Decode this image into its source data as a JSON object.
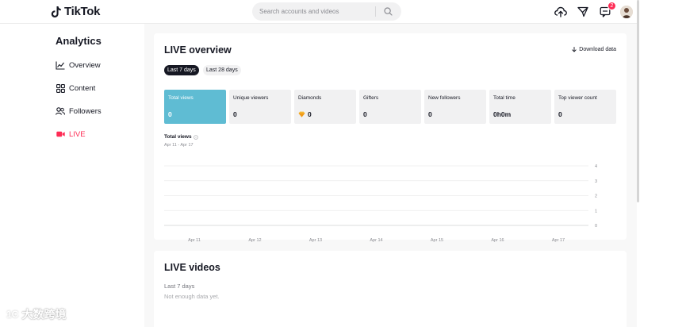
{
  "header": {
    "logo_text": "TikTok",
    "search_placeholder": "Search accounts and videos",
    "notification_count": "2"
  },
  "sidebar": {
    "title": "Analytics",
    "items": [
      {
        "label": "Overview",
        "icon": "line-chart-icon"
      },
      {
        "label": "Content",
        "icon": "grid-icon"
      },
      {
        "label": "Followers",
        "icon": "users-icon"
      },
      {
        "label": "LIVE",
        "icon": "live-icon",
        "active": true
      }
    ]
  },
  "overview": {
    "title": "LIVE overview",
    "download_label": "Download data",
    "ranges": [
      "Last 7 days",
      "Last 28 days"
    ],
    "selected_range": "Last 7 days",
    "metrics": [
      {
        "label": "Total views",
        "value": "0"
      },
      {
        "label": "Unique viewers",
        "value": "0"
      },
      {
        "label": "Diamonds",
        "value": "0"
      },
      {
        "label": "Gifters",
        "value": "0"
      },
      {
        "label": "New followers",
        "value": "0"
      },
      {
        "label": "Total time",
        "value": "0h0m"
      },
      {
        "label": "Top viewer count",
        "value": "0"
      }
    ]
  },
  "chart_data": {
    "type": "line",
    "title": "Total views",
    "subtitle": "Apr 11 - Apr 17",
    "categories": [
      "Apr 11",
      "Apr 12",
      "Apr 13",
      "Apr 14",
      "Apr 15",
      "Apr 16",
      "Apr 17"
    ],
    "series": [
      {
        "values": [
          0,
          0,
          0,
          0,
          0,
          0,
          0
        ]
      }
    ],
    "y_ticks": [
      "4",
      "3",
      "2",
      "1",
      "0"
    ],
    "ylim": [
      0,
      4
    ],
    "grid": true,
    "accent": "#5fbcd3"
  },
  "videos": {
    "title": "LIVE videos",
    "subtitle": "Last 7 days",
    "empty_text": "Not enough data yet."
  },
  "watermark": {
    "logo": "1C",
    "text": "大数跨境"
  },
  "colors": {
    "accent_red": "#fe2c55",
    "selected_metric": "#5fbcd3"
  }
}
